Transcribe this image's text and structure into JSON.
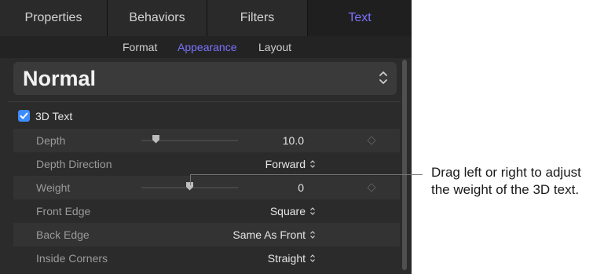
{
  "tabs": [
    {
      "label": "Properties"
    },
    {
      "label": "Behaviors"
    },
    {
      "label": "Filters"
    },
    {
      "label": "Text"
    }
  ],
  "active_tab": "Text",
  "subtabs": [
    {
      "label": "Format"
    },
    {
      "label": "Appearance"
    },
    {
      "label": "Layout"
    }
  ],
  "active_subtab": "Appearance",
  "preset": {
    "value": "Normal",
    "icon": "chevron-updown-icon"
  },
  "section": {
    "label": "3D Text",
    "checked": true
  },
  "params": {
    "depth": {
      "label": "Depth",
      "value": "10.0",
      "slider_position": 0.15
    },
    "depth_direction": {
      "label": "Depth Direction",
      "value": "Forward"
    },
    "weight": {
      "label": "Weight",
      "value": "0",
      "slider_position": 0.5
    },
    "front_edge": {
      "label": "Front Edge",
      "value": "Square"
    },
    "back_edge": {
      "label": "Back Edge",
      "value": "Same As Front"
    },
    "inside_corners": {
      "label": "Inside Corners",
      "value": "Straight"
    }
  },
  "callout": {
    "line1": "Drag left or right to adjust",
    "line2": "the weight of the 3D text."
  },
  "colors": {
    "accent": "#7b73ff",
    "checkbox": "#3d8bff",
    "panel_bg": "#2b2b2b"
  }
}
